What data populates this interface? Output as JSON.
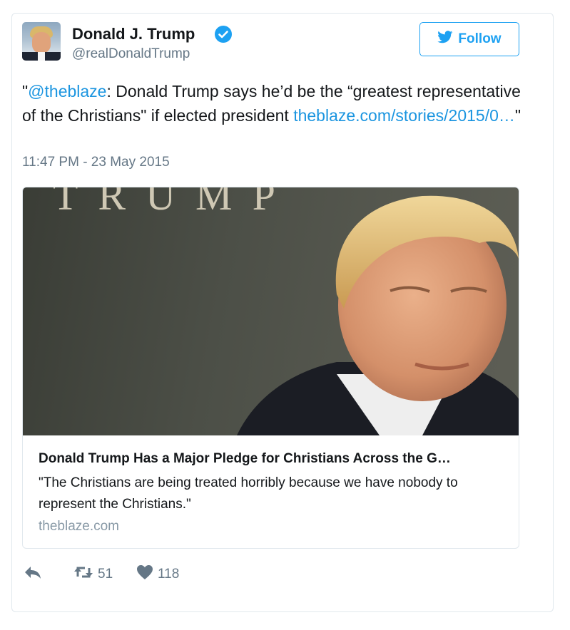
{
  "user": {
    "name": "Donald J. Trump",
    "handle": "@realDonaldTrump",
    "verified": true
  },
  "follow_button": {
    "label": "Follow",
    "icon": "twitter-bird-icon"
  },
  "tweet": {
    "quote_open": "\"",
    "mention": "@theblaze",
    "text": ": Donald Trump says he’d be the “greatest representative of the Christians\" if elected president ",
    "link": "theblaze.com/stories/2015/0…",
    "quote_close": "\"",
    "timestamp": "11:47 PM - 23 May 2015"
  },
  "card": {
    "backdrop_text": "TRUMP",
    "title": "Donald Trump Has a Major Pledge for Christians Across the G…",
    "description": "\"The Christians are being treated horribly because we have nobody to represent the Christians.\"",
    "domain": "theblaze.com"
  },
  "actions": {
    "reply": {
      "icon": "reply-icon"
    },
    "retweet": {
      "icon": "retweet-icon",
      "count": "51"
    },
    "like": {
      "icon": "heart-icon",
      "count": "118"
    }
  },
  "colors": {
    "accent": "#1da1f2",
    "link": "#1b95e0",
    "secondary_text": "#657786",
    "border": "#e1e8ed"
  }
}
